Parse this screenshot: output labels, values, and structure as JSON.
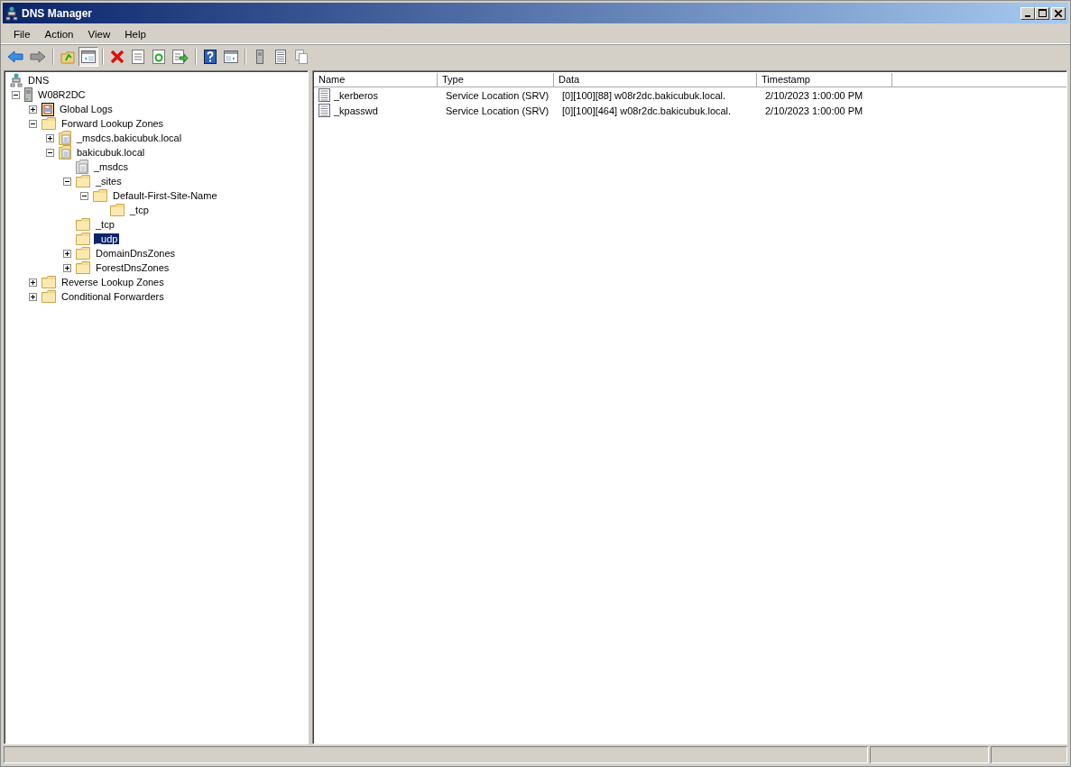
{
  "window": {
    "title": "DNS Manager"
  },
  "menu": [
    "File",
    "Action",
    "View",
    "Help"
  ],
  "toolbar": [
    [
      {
        "kind": "back",
        "pressed": false
      },
      {
        "kind": "forward",
        "pressed": false
      }
    ],
    [
      {
        "kind": "up",
        "pressed": false
      },
      {
        "kind": "tree",
        "pressed": true
      }
    ],
    [
      {
        "kind": "delete",
        "pressed": false
      },
      {
        "kind": "properties",
        "pressed": false
      },
      {
        "kind": "refresh",
        "pressed": false
      },
      {
        "kind": "export",
        "pressed": false
      }
    ],
    [
      {
        "kind": "help",
        "pressed": false
      },
      {
        "kind": "panel",
        "pressed": false
      }
    ],
    [
      {
        "kind": "server",
        "pressed": false
      },
      {
        "kind": "list",
        "pressed": false
      },
      {
        "kind": "copy",
        "pressed": false
      }
    ]
  ],
  "tree": [
    {
      "label": "DNS",
      "kind": "dns",
      "selected": false,
      "children": [
        {
          "label": "W08R2DC",
          "kind": "server",
          "selected": false,
          "expanded": true,
          "children": [
            {
              "label": "Global Logs",
              "kind": "logs",
              "selected": false,
              "expanded": false
            },
            {
              "label": "Forward Lookup Zones",
              "kind": "folder",
              "selected": false,
              "expanded": true,
              "children": [
                {
                  "label": "_msdcs.bakicubuk.local",
                  "kind": "zone",
                  "selected": false,
                  "expanded": false
                },
                {
                  "label": "bakicubuk.local",
                  "kind": "zone",
                  "selected": false,
                  "expanded": true,
                  "children": [
                    {
                      "label": "_msdcs",
                      "kind": "delegation",
                      "selected": false
                    },
                    {
                      "label": "_sites",
                      "kind": "folder",
                      "selected": false,
                      "expanded": true,
                      "children": [
                        {
                          "label": "Default-First-Site-Name",
                          "kind": "folder",
                          "selected": false,
                          "expanded": true,
                          "children": [
                            {
                              "label": "_tcp",
                              "kind": "folder",
                              "selected": false
                            }
                          ]
                        }
                      ]
                    },
                    {
                      "label": "_tcp",
                      "kind": "folder",
                      "selected": false
                    },
                    {
                      "label": "_udp",
                      "kind": "folder",
                      "selected": true
                    },
                    {
                      "label": "DomainDnsZones",
                      "kind": "folder",
                      "selected": false,
                      "expanded": false
                    },
                    {
                      "label": "ForestDnsZones",
                      "kind": "folder",
                      "selected": false,
                      "expanded": false
                    }
                  ]
                }
              ]
            },
            {
              "label": "Reverse Lookup Zones",
              "kind": "folder",
              "selected": false,
              "expanded": false
            },
            {
              "label": "Conditional Forwarders",
              "kind": "folder",
              "selected": false,
              "expanded": false
            }
          ]
        }
      ]
    }
  ],
  "table": {
    "columns": [
      "Name",
      "Type",
      "Data",
      "Timestamp"
    ],
    "rows": [
      {
        "name": "_kerberos",
        "type": "Service Location (SRV)",
        "data": "[0][100][88] w08r2dc.bakicubuk.local.",
        "timestamp": "2/10/2023 1:00:00 PM"
      },
      {
        "name": "_kpasswd",
        "type": "Service Location (SRV)",
        "data": "[0][100][464] w08r2dc.bakicubuk.local.",
        "timestamp": "2/10/2023 1:00:00 PM"
      }
    ]
  }
}
